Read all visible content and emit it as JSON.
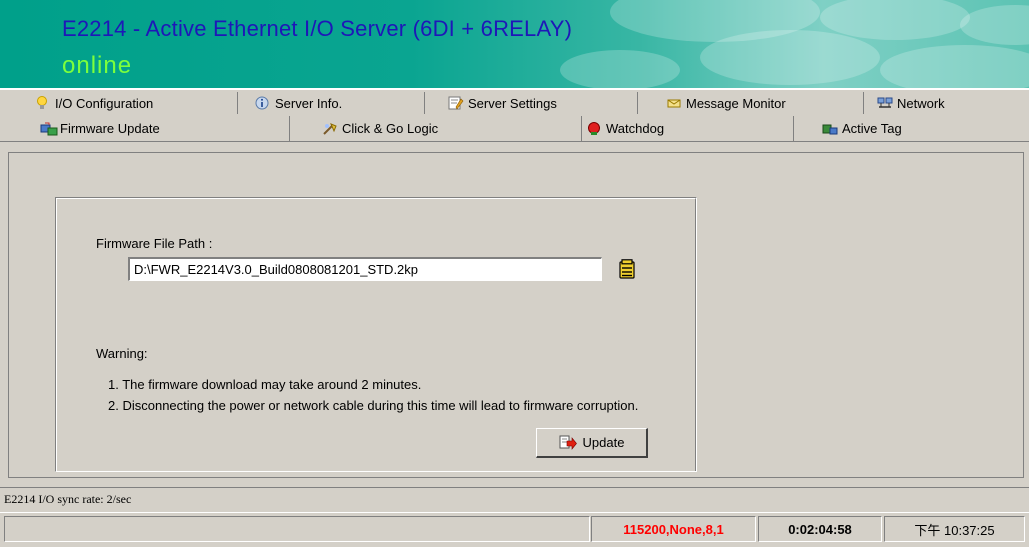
{
  "banner": {
    "title": "E2214 - Active Ethernet I/O Server (6DI + 6RELAY)",
    "status": "online",
    "title_color": "#1e17b8",
    "status_color": "#7cff3c"
  },
  "tabs_row1": [
    {
      "label": "I/O Configuration",
      "icon": "lightbulb-icon"
    },
    {
      "label": "Server Info.",
      "icon": "info-icon"
    },
    {
      "label": "Server Settings",
      "icon": "settings-doc-icon"
    },
    {
      "label": "Message Monitor",
      "icon": "message-icon"
    },
    {
      "label": "Network",
      "icon": "network-icon"
    }
  ],
  "tabs_row2": [
    {
      "label": "Firmware Update",
      "icon": "firmware-icon",
      "active": true
    },
    {
      "label": "Click & Go Logic",
      "icon": "logic-icon"
    },
    {
      "label": "Watchdog",
      "icon": "watchdog-icon"
    },
    {
      "label": "Active Tag",
      "icon": "tag-icon"
    }
  ],
  "firmware": {
    "path_label": "Firmware File Path :",
    "path_value": "D:\\FWR_E2214V3.0_Build0808081201_STD.2kp",
    "warning_title": "Warning:",
    "warning_lines": [
      "1. The firmware download may take around 2 minutes.",
      "2. Disconnecting the power or network cable during this time will lead to firmware corruption."
    ],
    "update_label": "Update"
  },
  "status": {
    "sync_rate": "E2214 I/O sync rate: 2/sec",
    "comm": "115200,None,8,1",
    "comm_color": "#ff0000",
    "elapsed": "0:02:04:58",
    "clock": "下午 10:37:25"
  }
}
